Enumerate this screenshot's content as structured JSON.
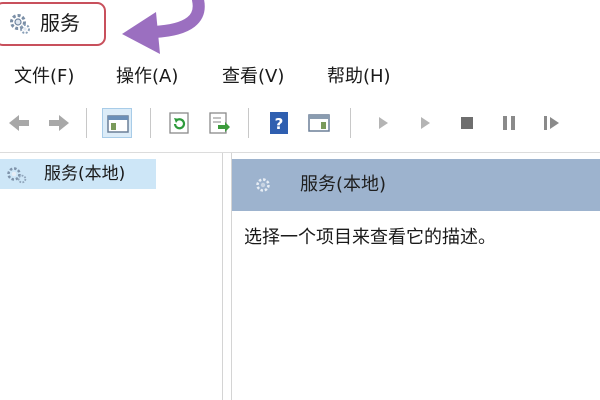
{
  "window": {
    "title": "服务",
    "icon": "gear-icon"
  },
  "menu": {
    "file": "文件(F)",
    "action": "操作(A)",
    "view": "查看(V)",
    "help": "帮助(H)"
  },
  "toolbar": {
    "buttons": [
      {
        "icon": "back-arrow-icon"
      },
      {
        "icon": "forward-arrow-icon"
      },
      {
        "icon": "show-hide-console-tree-icon",
        "active": true
      },
      {
        "icon": "refresh-icon"
      },
      {
        "icon": "export-list-icon"
      },
      {
        "icon": "help-icon"
      },
      {
        "icon": "show-hide-action-pane-icon"
      },
      {
        "icon": "start-service-icon"
      },
      {
        "icon": "start-service-alt-icon"
      },
      {
        "icon": "stop-service-icon"
      },
      {
        "icon": "pause-service-icon"
      },
      {
        "icon": "resume-service-icon"
      }
    ]
  },
  "tree": {
    "selected_node": "服务(本地)"
  },
  "detail": {
    "header_title": "服务(本地)",
    "description": "选择一个项目来查看它的描述。"
  },
  "colors": {
    "highlight_border": "#c8505c",
    "annotation_arrow": "#9b6fc0",
    "detail_header_bg": "#9db3ce",
    "tree_selection_bg": "#cde6f7"
  }
}
